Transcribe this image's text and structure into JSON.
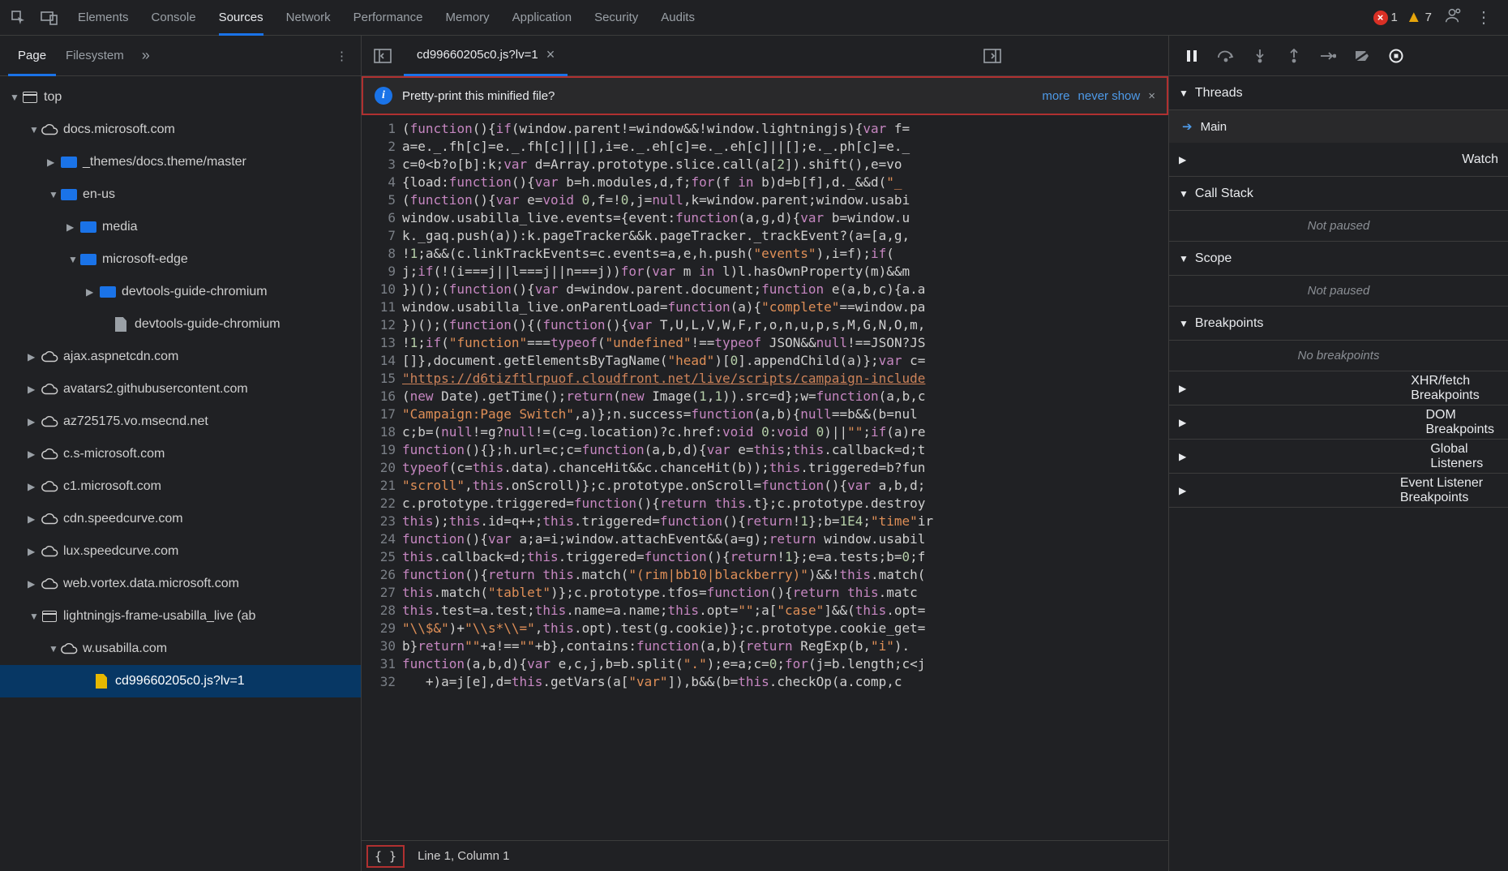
{
  "top": {
    "tabs": [
      "Elements",
      "Console",
      "Sources",
      "Network",
      "Performance",
      "Memory",
      "Application",
      "Security",
      "Audits"
    ],
    "active_tab": "Sources",
    "error_count": "1",
    "warning_count": "7"
  },
  "left": {
    "tabs": [
      "Page",
      "Filesystem"
    ],
    "active_tab": "Page",
    "tree": [
      {
        "label": "top",
        "icon": "win",
        "indent": 10,
        "expand": "down"
      },
      {
        "label": "docs.microsoft.com",
        "icon": "cloud",
        "indent": 34,
        "expand": "down"
      },
      {
        "label": "_themes/docs.theme/master",
        "icon": "folder",
        "indent": 58,
        "expand": "right"
      },
      {
        "label": "en-us",
        "icon": "folder",
        "indent": 58,
        "expand": "down"
      },
      {
        "label": "media",
        "icon": "folder",
        "indent": 82,
        "expand": "right"
      },
      {
        "label": "microsoft-edge",
        "icon": "folder",
        "indent": 82,
        "expand": "down"
      },
      {
        "label": "devtools-guide-chromium",
        "icon": "folder",
        "indent": 106,
        "expand": "right"
      },
      {
        "label": "devtools-guide-chromium",
        "icon": "file-l",
        "indent": 122,
        "expand": "none"
      },
      {
        "label": "ajax.aspnetcdn.com",
        "icon": "cloud",
        "indent": 34,
        "expand": "right"
      },
      {
        "label": "avatars2.githubusercontent.com",
        "icon": "cloud",
        "indent": 34,
        "expand": "right"
      },
      {
        "label": "az725175.vo.msecnd.net",
        "icon": "cloud",
        "indent": 34,
        "expand": "right"
      },
      {
        "label": "c.s-microsoft.com",
        "icon": "cloud",
        "indent": 34,
        "expand": "right"
      },
      {
        "label": "c1.microsoft.com",
        "icon": "cloud",
        "indent": 34,
        "expand": "right"
      },
      {
        "label": "cdn.speedcurve.com",
        "icon": "cloud",
        "indent": 34,
        "expand": "right"
      },
      {
        "label": "lux.speedcurve.com",
        "icon": "cloud",
        "indent": 34,
        "expand": "right"
      },
      {
        "label": "web.vortex.data.microsoft.com",
        "icon": "cloud",
        "indent": 34,
        "expand": "right"
      },
      {
        "label": "lightningjs-frame-usabilla_live (ab",
        "icon": "win",
        "indent": 34,
        "expand": "down"
      },
      {
        "label": "w.usabilla.com",
        "icon": "cloud",
        "indent": 58,
        "expand": "down"
      },
      {
        "label": "cd99660205c0.js?lv=1",
        "icon": "file-y",
        "indent": 98,
        "expand": "none",
        "selected": true
      }
    ]
  },
  "center": {
    "file_tab": "cd99660205c0.js?lv=1",
    "pretty_msg": "Pretty-print this minified file?",
    "pretty_actions": {
      "more": "more",
      "never": "never show"
    },
    "status": "Line 1, Column 1",
    "brace": "{ }",
    "code_lines": [
      {
        "n": 1,
        "html": "(<span class='kw'>function</span>(){<span class='kw'>if</span>(window.parent!=window&&!window.lightningjs){<span class='kw'>var</span> f="
      },
      {
        "n": 2,
        "html": "a=e._.fh[c]=e._.fh[c]||[],i=e._.eh[c]=e._.eh[c]||[];e._.ph[c]=e._"
      },
      {
        "n": 3,
        "html": "c=0&lt;b?o[b]:k;<span class='kw'>var</span> d=Array.prototype.slice.call(a[<span class='num'>2</span>]).shift(),e=vo"
      },
      {
        "n": 4,
        "html": "{load:<span class='kw'>function</span>(){<span class='kw'>var</span> b=h.modules,d,f;<span class='kw'>for</span>(f <span class='kw'>in</span> b)d=b[f],d._&&d(<span class='str'>\"_</span>"
      },
      {
        "n": 5,
        "html": "(<span class='kw'>function</span>(){<span class='kw'>var</span> e=<span class='kw'>void</span> <span class='num'>0</span>,f=!<span class='num'>0</span>,j=<span class='kw'>null</span>,k=window.parent;window.usabi"
      },
      {
        "n": 6,
        "html": "window.usabilla_live.events={event:<span class='kw'>function</span>(a,g,d){<span class='kw'>var</span> b=window.u"
      },
      {
        "n": 7,
        "html": "k._gaq.push(a)):k.pageTracker&&k.pageTracker._trackEvent?(a=[a,g,"
      },
      {
        "n": 8,
        "html": "!<span class='num'>1</span>;a&&(c.linkTrackEvents=c.events=a,e,h.push(<span class='str'>\"events\"</span>),i=f);<span class='kw'>if</span>("
      },
      {
        "n": 9,
        "html": "j;<span class='kw'>if</span>(!(i===j||l===j||n===j))<span class='kw'>for</span>(<span class='kw'>var</span> m <span class='kw'>in</span> l)l.hasOwnProperty(m)&&m"
      },
      {
        "n": 10,
        "html": "})();(<span class='kw'>function</span>(){<span class='kw'>var</span> d=window.parent.document;<span class='kw'>function</span> e(a,b,c){a.a"
      },
      {
        "n": 11,
        "html": "window.usabilla_live.onParentLoad=<span class='kw'>function</span>(a){<span class='str'>\"complete\"</span>==window.pa"
      },
      {
        "n": 12,
        "html": "})();(<span class='kw'>function</span>(){(<span class='kw'>function</span>(){<span class='kw'>var</span> T,U,L,V,W,F,r,o,n,u,p,s,M,G,N,O,m,"
      },
      {
        "n": 13,
        "html": "!<span class='num'>1</span>;<span class='kw'>if</span>(<span class='str'>\"function\"</span>===<span class='kw'>typeof</span>(<span class='str'>\"undefined\"</span>!==<span class='kw'>typeof</span> JSON&&<span class='kw'>null</span>!==JSON?JS"
      },
      {
        "n": 14,
        "html": "[]},document.getElementsByTagName(<span class='str'>\"head\"</span>)[<span class='num'>0</span>].appendChild(a)};<span class='kw'>var</span> c="
      },
      {
        "n": 15,
        "html": "<span class='url'>\"https://d6tizftlrpuof.cloudfront.net/live/scripts/campaign-include</span>"
      },
      {
        "n": 16,
        "html": "(<span class='kw'>new</span> Date).getTime();<span class='kw'>return</span>(<span class='kw'>new</span> Image(<span class='num'>1</span>,<span class='num'>1</span>)).src=d};w=<span class='kw'>function</span>(a,b,c"
      },
      {
        "n": 17,
        "html": "<span class='str'>\"Campaign:Page Switch\"</span>,a)};n.success=<span class='kw'>function</span>(a,b){<span class='kw'>null</span>==b&&(b=nul"
      },
      {
        "n": 18,
        "html": "c;b=(<span class='kw'>null</span>!=g?<span class='kw'>null</span>!=(c=g.location)?c.href:<span class='kw'>void</span> <span class='num'>0</span>:<span class='kw'>void</span> <span class='num'>0</span>)||<span class='str'>\"\"</span>;<span class='kw'>if</span>(a)re"
      },
      {
        "n": 19,
        "html": "<span class='kw'>function</span>(){};h.url=c;c=<span class='kw'>function</span>(a,b,d){<span class='kw'>var</span> e=<span class='kw'>this</span>;<span class='kw'>this</span>.callback=d;t"
      },
      {
        "n": 20,
        "html": "<span class='kw'>typeof</span>(c=<span class='kw'>this</span>.data).chanceHit&&c.chanceHit(b));<span class='kw'>this</span>.triggered=b?fun"
      },
      {
        "n": 21,
        "html": "<span class='str'>\"scroll\"</span>,<span class='kw'>this</span>.onScroll)};c.prototype.onScroll=<span class='kw'>function</span>(){<span class='kw'>var</span> a,b,d;"
      },
      {
        "n": 22,
        "html": "c.prototype.triggered=<span class='kw'>function</span>(){<span class='kw'>return</span> <span class='kw'>this</span>.t};c.prototype.destroy"
      },
      {
        "n": 23,
        "html": "<span class='kw'>this</span>);<span class='kw'>this</span>.id=q++;<span class='kw'>this</span>.triggered=<span class='kw'>function</span>(){<span class='kw'>return</span>!<span class='num'>1</span>};b=<span class='num'>1E4</span>;<span class='str'>\"time\"</span>ir"
      },
      {
        "n": 24,
        "html": "<span class='kw'>function</span>(){<span class='kw'>var</span> a;a=i;window.attachEvent&&(a=g);<span class='kw'>return</span> window.usabil"
      },
      {
        "n": 25,
        "html": "<span class='kw'>this</span>.callback=d;<span class='kw'>this</span>.triggered=<span class='kw'>function</span>(){<span class='kw'>return</span>!<span class='num'>1</span>};e=a.tests;b=<span class='num'>0</span>;f"
      },
      {
        "n": 26,
        "html": "<span class='kw'>function</span>(){<span class='kw'>return</span> <span class='kw'>this</span>.match(<span class='str'>\"(rim|bb10|blackberry)\"</span>)&&!<span class='kw'>this</span>.match("
      },
      {
        "n": 27,
        "html": "<span class='kw'>this</span>.match(<span class='str'>\"tablet\"</span>)};c.prototype.tfos=<span class='kw'>function</span>(){<span class='kw'>return</span> <span class='kw'>this</span>.matc"
      },
      {
        "n": 28,
        "html": "<span class='kw'>this</span>.test=a.test;<span class='kw'>this</span>.name=a.name;<span class='kw'>this</span>.opt=<span class='str'>\"\"</span>;a[<span class='str'>\"case\"</span>]&&(<span class='kw'>this</span>.opt="
      },
      {
        "n": 29,
        "html": "<span class='str'>\"\\\\$&\"</span>)+<span class='str'>\"\\\\s*\\\\=\"</span>,<span class='kw'>this</span>.opt).test(g.cookie)};c.prototype.cookie_get="
      },
      {
        "n": 30,
        "html": "b}<span class='kw'>return</span><span class='str'>\"\"</span>+a!==<span class='str'>\"\"</span>+b},contains:<span class='kw'>function</span>(a,b){<span class='kw'>return</span> RegExp(b,<span class='str'>\"i\"</span>)."
      },
      {
        "n": 31,
        "html": "<span class='kw'>function</span>(a,b,d){<span class='kw'>var</span> e,c,j,b=b.split(<span class='str'>\".\"</span>);e=a;c=<span class='num'>0</span>;<span class='kw'>for</span>(j=b.length;c&lt;j"
      },
      {
        "n": 32,
        "html": "   +)a=j[e],d=<span class='kw'>this</span>.getVars(a[<span class='str'>\"var\"</span>]),b&&(b=<span class='kw'>this</span>.checkOp(a.comp,c"
      }
    ]
  },
  "right": {
    "sections": {
      "threads": "Threads",
      "main_thread": "Main",
      "watch": "Watch",
      "callstack": "Call Stack",
      "callstack_body": "Not paused",
      "scope": "Scope",
      "scope_body": "Not paused",
      "breakpoints": "Breakpoints",
      "breakpoints_body": "No breakpoints",
      "xhr": "XHR/fetch Breakpoints",
      "dom": "DOM Breakpoints",
      "global": "Global Listeners",
      "event": "Event Listener Breakpoints"
    }
  }
}
